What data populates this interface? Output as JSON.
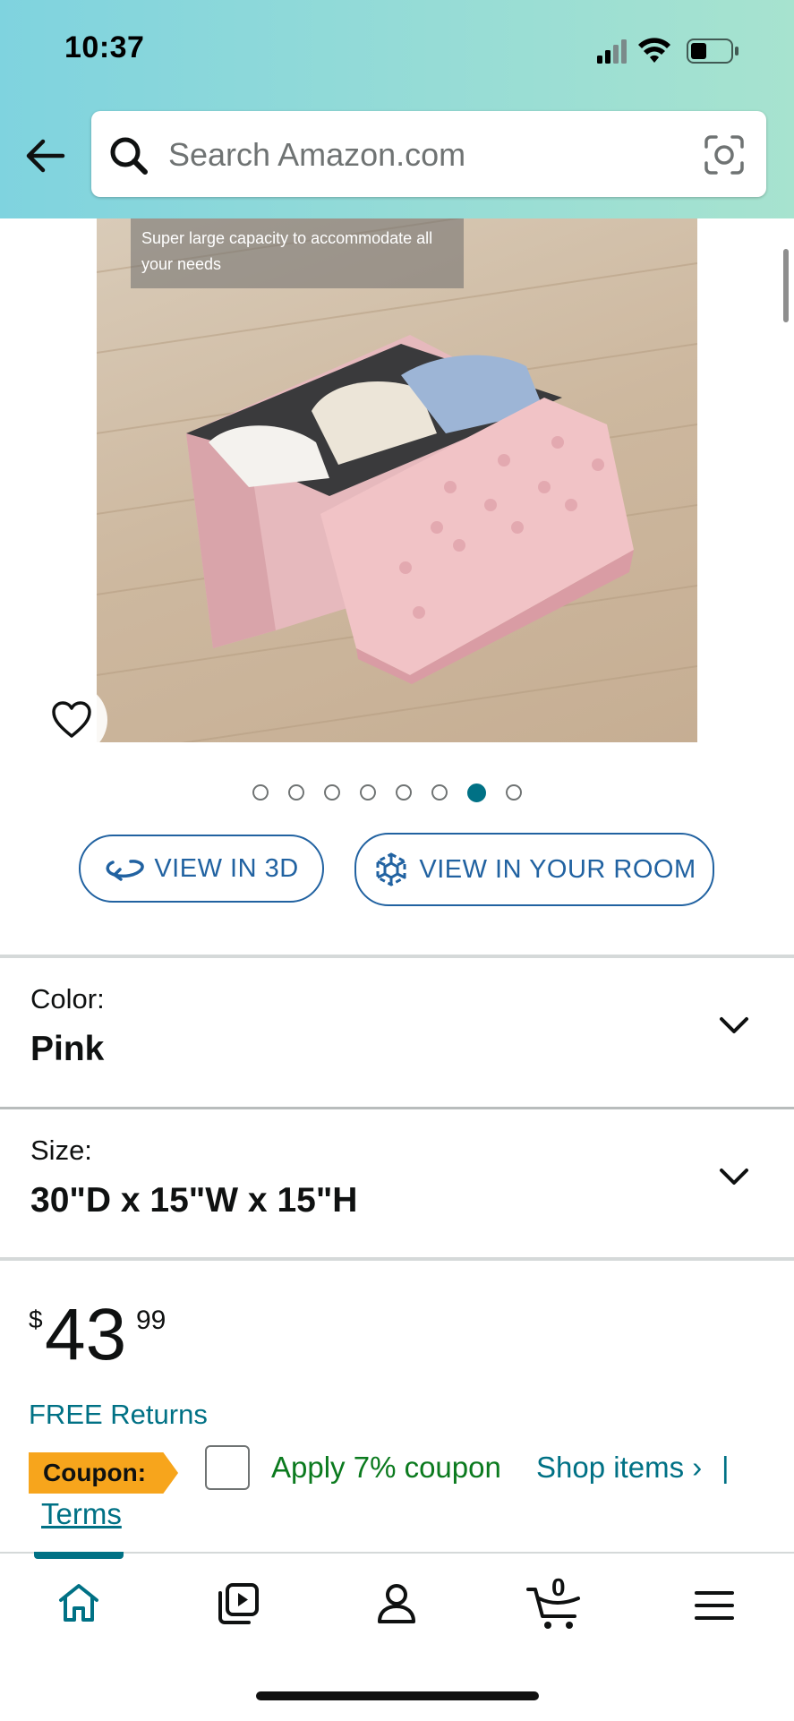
{
  "status_bar": {
    "time": "10:37"
  },
  "search": {
    "placeholder": "Search Amazon.com"
  },
  "product_image": {
    "caption": "Super large capacity to accommodate all your needs",
    "carousel_count": 8,
    "active_index": 7
  },
  "buttons": {
    "view_3d": "VIEW IN 3D",
    "view_room": "VIEW IN YOUR ROOM"
  },
  "color_selector": {
    "label": "Color:",
    "value": "Pink"
  },
  "size_selector": {
    "label": "Size:",
    "value": "30\"D x 15\"W x 15\"H"
  },
  "price": {
    "symbol": "$",
    "whole": "43",
    "fraction": "99"
  },
  "free_returns": "FREE Returns",
  "coupon": {
    "badge": "Coupon:",
    "apply_text": "Apply 7% coupon",
    "shop_items": "Shop items ›",
    "separator": "|",
    "terms": "Terms"
  },
  "bottom_nav": {
    "items": [
      "home",
      "video",
      "account",
      "cart",
      "menu"
    ],
    "cart_count": "0"
  },
  "colors": {
    "header_gradient_start": "#7fd3df",
    "header_gradient_end": "#a7e3cf",
    "link": "#007185",
    "button_blue": "#2162a1",
    "coupon_badge": "#f7a51c",
    "coupon_green": "#0b7a1e"
  }
}
